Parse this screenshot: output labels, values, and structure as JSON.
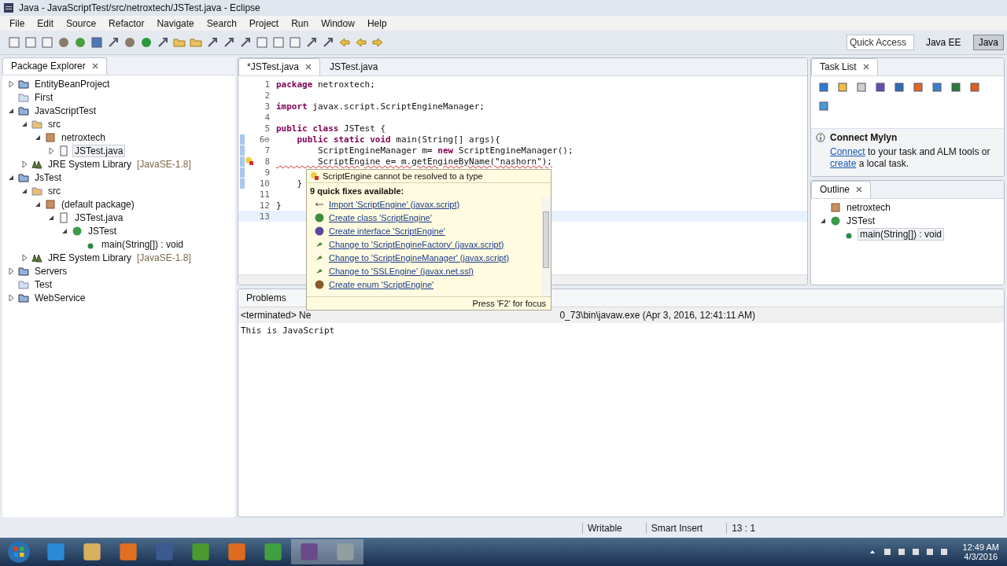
{
  "window": {
    "title": "Java - JavaScriptTest/src/netroxtech/JSTest.java - Eclipse"
  },
  "menu": [
    "File",
    "Edit",
    "Source",
    "Refactor",
    "Navigate",
    "Search",
    "Project",
    "Run",
    "Window",
    "Help"
  ],
  "quick_access": {
    "placeholder": "Quick Access"
  },
  "perspectives": [
    {
      "label": "Java EE",
      "selected": false
    },
    {
      "label": "Java",
      "selected": true
    }
  ],
  "explorer": {
    "title": "Package Explorer",
    "items": [
      {
        "label": "EntityBeanProject",
        "kind": "project",
        "expanded": false,
        "selected": false
      },
      {
        "label": "First",
        "kind": "folder",
        "selected": false
      },
      {
        "label": "JavaScriptTest",
        "kind": "project",
        "expanded": true,
        "selected": false,
        "children": [
          {
            "label": "src",
            "kind": "src",
            "expanded": true,
            "selected": false,
            "children": [
              {
                "label": "netroxtech",
                "kind": "package",
                "expanded": true,
                "selected": false,
                "children": [
                  {
                    "label": "JSTest.java",
                    "kind": "file",
                    "expanded": false,
                    "selected": true
                  }
                ]
              }
            ]
          },
          {
            "label": "JRE System Library",
            "suffix": "[JavaSE-1.8]",
            "kind": "library",
            "expanded": false,
            "selected": false
          }
        ]
      },
      {
        "label": "JsTest",
        "kind": "project",
        "expanded": true,
        "selected": false,
        "children": [
          {
            "label": "src",
            "kind": "src",
            "expanded": true,
            "selected": false,
            "children": [
              {
                "label": "(default package)",
                "kind": "package",
                "expanded": true,
                "selected": false,
                "children": [
                  {
                    "label": "JSTest.java",
                    "kind": "file",
                    "expanded": true,
                    "selected": false,
                    "children": [
                      {
                        "label": "JSTest",
                        "kind": "class",
                        "expanded": true,
                        "selected": false,
                        "children": [
                          {
                            "label": "main(String[]) : void",
                            "kind": "method",
                            "selected": false
                          }
                        ]
                      }
                    ]
                  }
                ]
              }
            ]
          },
          {
            "label": "JRE System Library",
            "suffix": "[JavaSE-1.8]",
            "kind": "library",
            "expanded": false,
            "selected": false
          }
        ]
      },
      {
        "label": "Servers",
        "kind": "project",
        "expanded": false,
        "selected": false
      },
      {
        "label": "Test",
        "kind": "folder",
        "selected": false
      },
      {
        "label": "WebService",
        "kind": "project",
        "expanded": false,
        "selected": false
      }
    ]
  },
  "editor": {
    "tabs": [
      {
        "label": "*JSTest.java",
        "selected": true
      },
      {
        "label": "JSTest.java",
        "selected": false
      }
    ],
    "lines": [
      {
        "number": "1",
        "code": "**package** netroxtech;",
        "changed": false,
        "error": false,
        "current": false
      },
      {
        "number": "2",
        "changed": false,
        "error": false,
        "current": false
      },
      {
        "number": "3",
        "code": "**import** javax.script.ScriptEngineManager;",
        "changed": false,
        "error": false,
        "current": false
      },
      {
        "number": "4",
        "changed": false,
        "error": false,
        "current": false
      },
      {
        "number": "5",
        "code": "**public** **class** JSTest {",
        "changed": false,
        "error": false,
        "current": false
      },
      {
        "number": "6⊖",
        "code": "    **public** **static** **void** main(String[] args){",
        "changed": true,
        "error": false,
        "current": false
      },
      {
        "number": "7",
        "code": "        ScriptEngineManager m= **new** ScriptEngineManager();",
        "changed": true,
        "error": false,
        "current": false
      },
      {
        "number": "8",
        "code": "        ScriptEngine e= m.getEngineByName(\"nashorn\");",
        "changed": true,
        "error": true,
        "current": false
      },
      {
        "number": "9",
        "changed": true,
        "error": false,
        "current": false
      },
      {
        "number": "10",
        "code": "    }",
        "changed": true,
        "error": false,
        "current": false
      },
      {
        "number": "11",
        "changed": false,
        "error": false,
        "current": false
      },
      {
        "number": "12",
        "code": "}",
        "changed": false,
        "error": false,
        "current": false
      },
      {
        "number": "13",
        "changed": false,
        "error": false,
        "current": true
      }
    ]
  },
  "quick_fix": {
    "problem": "ScriptEngine cannot be resolved to a type",
    "count_label": "9 quick fixes available:",
    "footer": "Press 'F2' for focus",
    "fixes": [
      {
        "label": "Import 'ScriptEngine' (javax.script)",
        "kind": "import"
      },
      {
        "label": "Create class 'ScriptEngine'",
        "kind": "class"
      },
      {
        "label": "Create interface 'ScriptEngine'",
        "kind": "interface"
      },
      {
        "label": "Change to 'ScriptEngineFactory' (javax.script)",
        "kind": "change"
      },
      {
        "label": "Change to 'ScriptEngineManager' (javax.script)",
        "kind": "change"
      },
      {
        "label": "Change to 'SSLEngine' (javax.net.ssl)",
        "kind": "change"
      },
      {
        "label": "Create enum 'ScriptEngine'",
        "kind": "enum"
      }
    ]
  },
  "task_list": {
    "title": "Task List",
    "mylyn_title": "Connect Mylyn",
    "mylyn_link1": "Connect",
    "mylyn_text1": " to your task and ALM tools or",
    "mylyn_link2": "create",
    "mylyn_text2": " a local task."
  },
  "outline": {
    "title": "Outline",
    "items": [
      {
        "label": "netroxtech",
        "kind": "package",
        "selected": false
      },
      {
        "label": "JSTest",
        "kind": "class",
        "expanded": true,
        "selected": false,
        "children": [
          {
            "label": "main(String[]) : void",
            "kind": "method",
            "selected": true
          }
        ]
      }
    ]
  },
  "console": {
    "tab": "Problems",
    "header": [
      "<terminated> Ne",
      "0_73\\bin\\javaw.exe (Apr 3, 2016, 12:41:11 AM)"
    ],
    "output": "This is JavaScript"
  },
  "status_bar": [
    "Writable",
    "Smart Insert",
    "13 : 1"
  ],
  "taskbar": {
    "time": "12:49 AM",
    "date": "4/3/2016"
  }
}
